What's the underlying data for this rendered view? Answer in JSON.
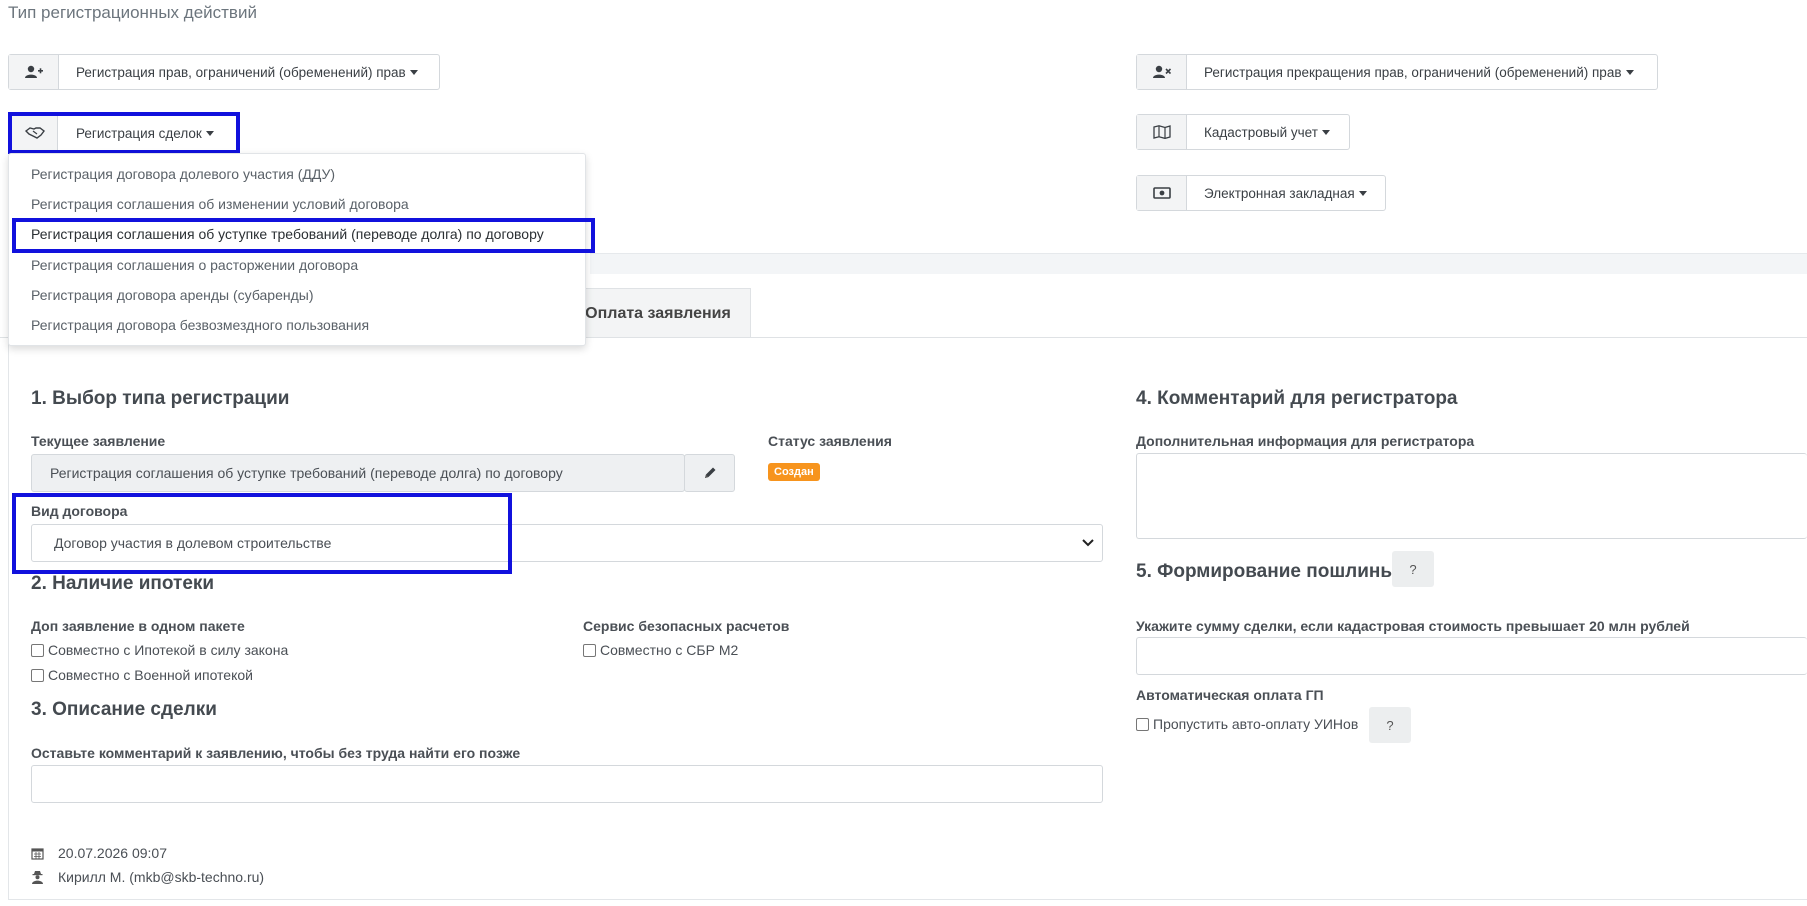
{
  "section_title": "Тип регистрационных действий",
  "buttons": {
    "rights": {
      "label": "Регистрация прав, ограничений (обременений) прав",
      "icon": "user-plus-icon"
    },
    "deals": {
      "label": "Регистрация сделок",
      "icon": "handshake-icon"
    },
    "termination": {
      "label": "Регистрация прекращения прав, ограничений (обременений) прав",
      "icon": "user-times-icon"
    },
    "cadastral": {
      "label": "Кадастровый учет",
      "icon": "map-icon"
    },
    "mortgage": {
      "label": "Электронная закладная",
      "icon": "money-bill-icon"
    }
  },
  "dropdown": {
    "items": [
      "Регистрация договора долевого участия (ДДУ)",
      "Регистрация соглашения об изменении условий договора",
      "Регистрация соглашения об уступке требований (переводе долга) по договору",
      "Регистрация соглашения о расторжении договора",
      "Регистрация договора аренды (субаренды)",
      "Регистрация договора безвозмездного пользования"
    ],
    "active_index": 2
  },
  "tab": {
    "label": "Оплата заявления"
  },
  "section1": {
    "title": "1. Выбор типа регистрации",
    "current_label": "Текущее заявление",
    "current_value": "Регистрация соглашения об уступке требований (переводе долга) по договору",
    "status_label": "Статус заявления",
    "status_value": "Создан",
    "status_color": "#f7941d",
    "contract_label": "Вид договора",
    "contract_value": "Договор участия в долевом строительстве"
  },
  "section2": {
    "title": "2. Наличие ипотеки",
    "dop_label": "Доп заявление в одном пакете",
    "cb1": "Совместно с Ипотекой в силу закона",
    "cb2": "Совместно с Военной ипотекой",
    "sbr_label": "Сервис безопасных расчетов",
    "cb3": "Совместно с СБР М2"
  },
  "section3": {
    "title": "3. Описание сделки",
    "comment_label": "Оставьте комментарий к заявлению, чтобы без труда найти его позже"
  },
  "section4": {
    "title": "4. Комментарий для регистратора",
    "info_label": "Дополнительная информация для регистратора"
  },
  "section5": {
    "title": "5. Формирование пошлины",
    "help": "?",
    "sum_label": "Укажите сумму сделки, если кадастровая стоимость превышает 20 млн рублей",
    "auto_label": "Автоматическая оплата ГП",
    "cb_skip": "Пропустить авто-оплату УИНов",
    "help2": "?"
  },
  "footer": {
    "date": "20.07.2026 09:07",
    "user": "Кирилл М. (mkb@skb-techno.ru)"
  },
  "highlight_color": "#1111dd"
}
